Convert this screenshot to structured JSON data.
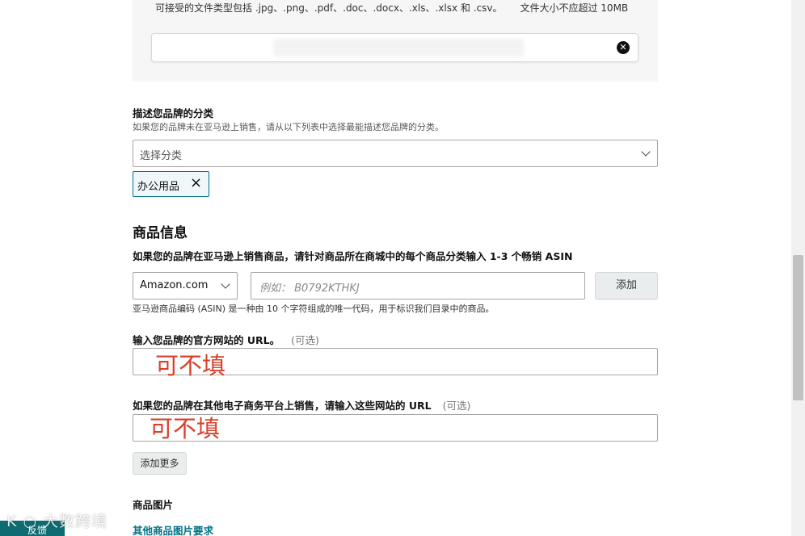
{
  "upload": {
    "hint_types": "可接受的文件类型包括 .jpg、.png、.pdf、.doc、.docx、.xls、.xlsx 和 .csv。",
    "hint_size": "文件大小不应超过 10MB"
  },
  "category": {
    "label": "描述您品牌的分类",
    "hint": "如果您的品牌未在亚马逊上销售，请从以下列表中选择最能描述您品牌的分类。",
    "placeholder": "选择分类",
    "selected_tag": "办公用品"
  },
  "product_info": {
    "title": "商品信息",
    "asin_label": "如果您的品牌在亚马逊上销售商品，请针对商品所在商城中的每个商品分类输入 1-3 个畅销 ASIN",
    "marketplace_value": "Amazon.com",
    "asin_placeholder": "例如： B0792KTHKJ",
    "add_label": "添加",
    "asin_hint": "亚马逊商品编码 (ASIN) 是一种由 10 个字符组成的唯一代码，用于标识我们目录中的商品。",
    "website_label": "输入您品牌的官方网站的 URL。",
    "optional": "(可选)",
    "website_annotation": "可不填",
    "other_platforms_label": "如果您的品牌在其他电子商务平台上销售，请输入这些网站的 URL",
    "other_platforms_annotation": "可不填",
    "add_more_label": "添加更多"
  },
  "images": {
    "label": "商品图片",
    "link": "其他商品图片要求"
  },
  "feedback": {
    "label": "反馈",
    "watermark": "K ○ 大数跨境"
  },
  "colors": {
    "accent": "#007185",
    "annotation": "#d9412b"
  }
}
